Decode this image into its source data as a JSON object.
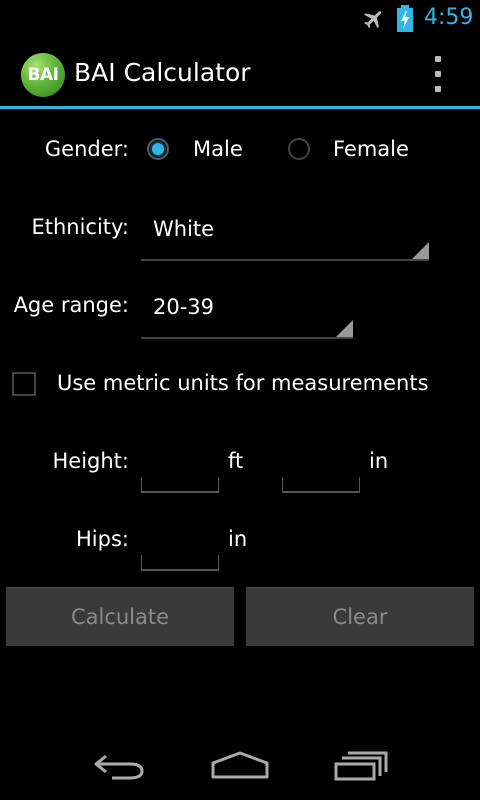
{
  "status_bar": {
    "time": "4:59",
    "icons": [
      "airplane-icon",
      "battery-charging-icon"
    ],
    "accent_color": "#33b5e5"
  },
  "action_bar": {
    "app_icon_text": "BAI",
    "title": "BAI Calculator",
    "overflow_icon": "overflow-menu-icon"
  },
  "form": {
    "gender": {
      "label": "Gender:",
      "options": [
        {
          "label": "Male",
          "checked": true
        },
        {
          "label": "Female",
          "checked": false
        }
      ]
    },
    "ethnicity": {
      "label": "Ethnicity:",
      "selected": "White"
    },
    "age_range": {
      "label": "Age range:",
      "selected": "20-39"
    },
    "metric": {
      "label": "Use metric units for measurements",
      "checked": false
    },
    "height": {
      "label": "Height:",
      "feet_value": "",
      "feet_unit": "ft",
      "inches_value": "",
      "inches_unit": "in"
    },
    "hips": {
      "label": "Hips:",
      "value": "",
      "unit": "in"
    }
  },
  "buttons": {
    "calculate": "Calculate",
    "clear": "Clear"
  },
  "nav_bar": {
    "icons": [
      "back-icon",
      "home-icon",
      "recent-apps-icon"
    ]
  }
}
